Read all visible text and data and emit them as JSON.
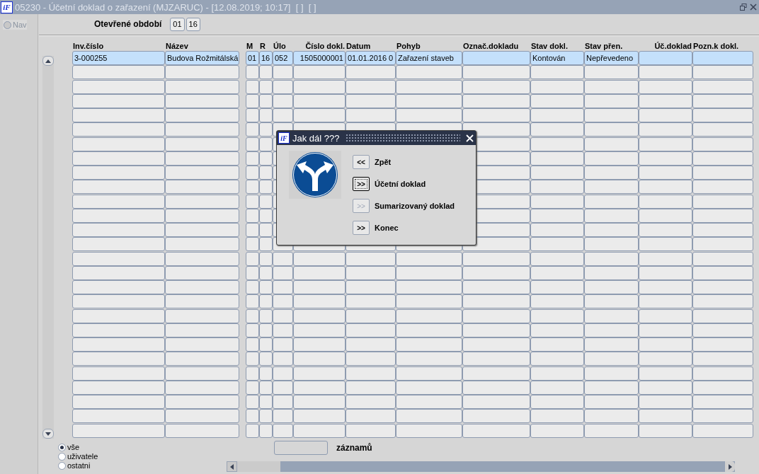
{
  "window": {
    "logo": "iF",
    "title": "05230 - Účetní doklad o zařazení (MJZARUC) - [12.08.2019; 10:17]  [ ]  [ ]"
  },
  "nav": {
    "label": "Nav",
    "selected": false
  },
  "period": {
    "label": "Otevřené období",
    "month": "01",
    "year": "16"
  },
  "table": {
    "columns": [
      "Inv.číslo",
      "Název",
      "M",
      "R",
      "Úlo",
      "Číslo dokl.",
      "Datum",
      "Pohyb",
      "Označ.dokladu",
      "Stav dokl.",
      "Stav přen.",
      "Úč.doklad",
      "Pozn.k dokl."
    ],
    "rows": [
      {
        "selected": true,
        "cells": [
          "3-000255",
          "Budova Rožmitálská",
          "01",
          "16",
          "052",
          "1505000001",
          "01.01.2016 0",
          "Zařazení staveb",
          null,
          "Kontován",
          "Nepřevedeno",
          null,
          null
        ]
      }
    ]
  },
  "filter": [
    {
      "label": "vše",
      "selected": true
    },
    {
      "label": "uživatele",
      "selected": false
    },
    {
      "label": "ostatni",
      "selected": false
    }
  ],
  "records": {
    "label": "záznamů"
  },
  "dialog": {
    "logo": "iF",
    "title": "Jak dál ???",
    "options": [
      {
        "button": "<<",
        "label": "Zpět",
        "disabled": false,
        "focused": false
      },
      {
        "button": ">>",
        "label": "Účetní doklad",
        "disabled": false,
        "focused": true
      },
      {
        "button": ">>",
        "label": "Sumarizovaný doklad",
        "disabled": true,
        "focused": false
      },
      {
        "button": ">>",
        "label": "Konec",
        "disabled": false,
        "focused": false
      }
    ]
  }
}
